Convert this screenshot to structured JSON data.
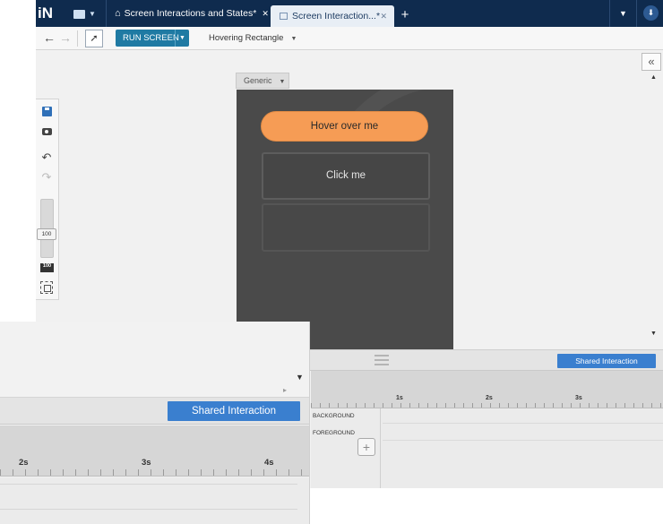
{
  "app": {
    "logo_text": "iN",
    "tabs": [
      {
        "label": "Screen Interactions and States*",
        "close": "✕"
      },
      {
        "label": "Screen Interaction...*",
        "close": "✕"
      }
    ],
    "new_tab": "+"
  },
  "toolbar": {
    "back_icon": "←",
    "forward_icon": "→",
    "run_label": "RUN SCREEN",
    "state_selector": "Hovering Rectangle"
  },
  "canvas": {
    "collapse_icon": "«",
    "device_label": "Generic",
    "hover_button": "Hover over me",
    "click_button": "Click me"
  },
  "left_tools": {
    "zoom_value": "100",
    "actual_size": "100"
  },
  "timeline": {
    "shared_button": "Shared Interaction",
    "ticks": [
      "1s",
      "2s",
      "3s",
      "4s"
    ],
    "tracks": [
      "BACKGROUND",
      "FOREGROUND"
    ],
    "add_icon": "+"
  },
  "zoom_panel": {
    "shared_button": "Shared Interaction",
    "ticks": [
      "2s",
      "3s",
      "4s"
    ]
  },
  "colors": {
    "titlebar": "#0f2b4e",
    "run_button": "#1f7aa3",
    "accent_blue": "#3a7fcf",
    "hover_button": "#f69c55",
    "screen_bg": "#4a4a4a"
  }
}
